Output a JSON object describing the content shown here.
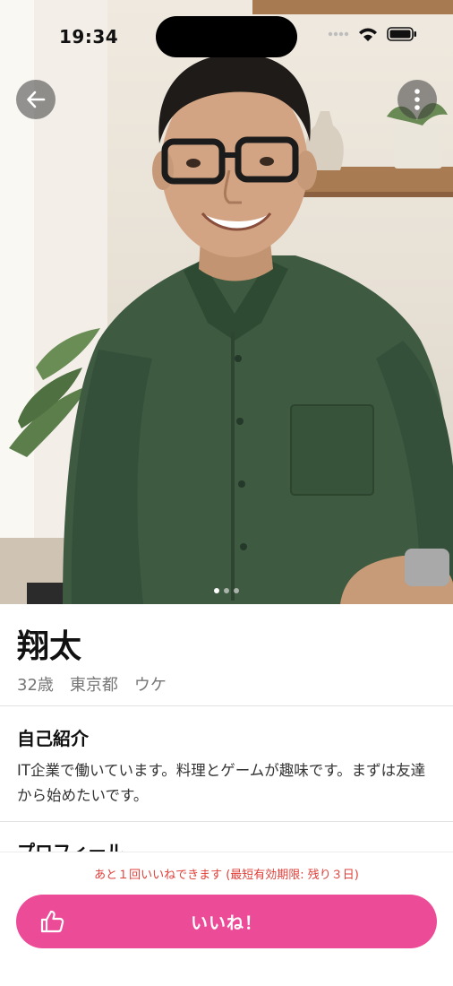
{
  "status_bar": {
    "time": "19:34"
  },
  "profile": {
    "name": "翔太",
    "age": "32歳",
    "location": "東京都",
    "role": "ウケ",
    "photo_count": 3,
    "active_photo": 1
  },
  "sections": {
    "bio_title": "自己紹介",
    "bio_text": "IT企業で働いています。料理とゲームが趣味です。まずは友達から始めたいです。",
    "profile_title": "プロフィール"
  },
  "like": {
    "notice": "あと１回いいねできます (最短有効期限: 残り３日)",
    "button_label": "いいね！"
  },
  "icons": {
    "back": "arrow-left-icon",
    "more": "more-vertical-icon",
    "like": "thumbs-up-icon"
  },
  "colors": {
    "like_button": "#ec4b98",
    "notice_text": "#e0403a"
  }
}
